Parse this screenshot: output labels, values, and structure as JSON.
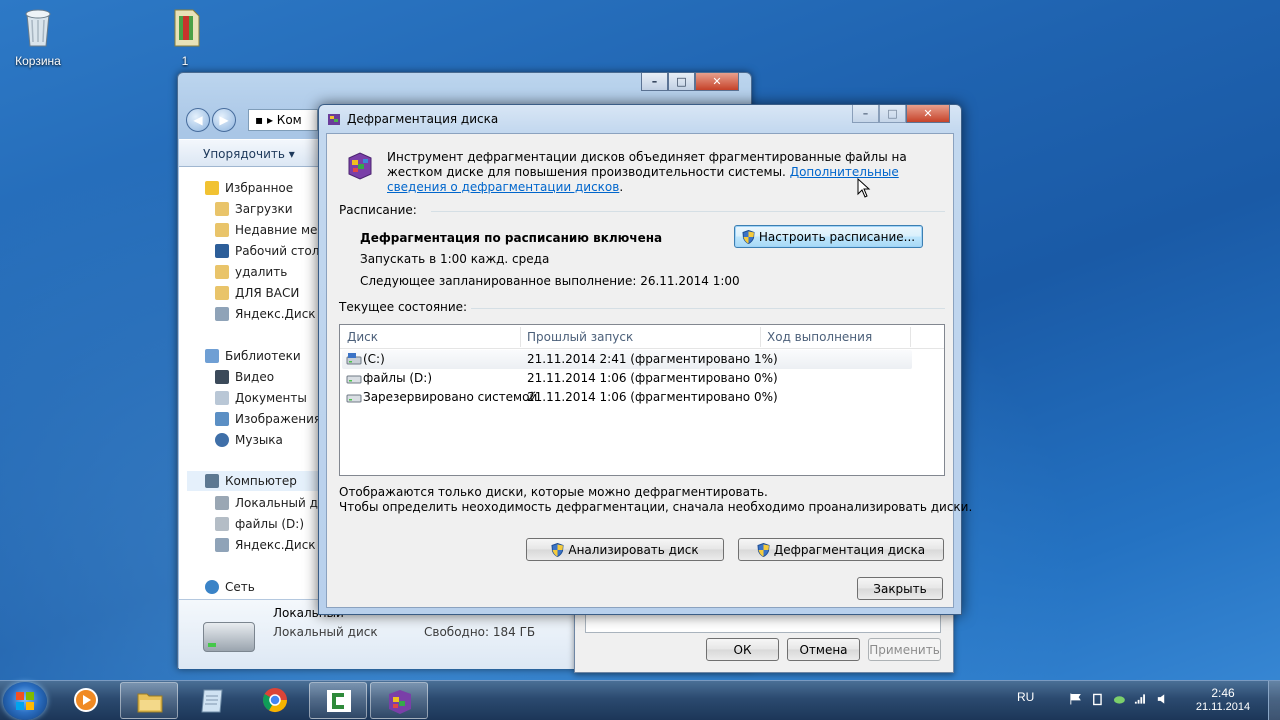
{
  "desktop": {
    "icons": [
      {
        "label": "Корзина",
        "icon": "recycle-bin-icon"
      },
      {
        "label": "1",
        "icon": "winrar-archive-icon"
      }
    ]
  },
  "explorer": {
    "address": "Ком",
    "toolbar": {
      "organize": "Упорядочить"
    },
    "nav": {
      "favorites": "Избранное",
      "downloads": "Загрузки",
      "recent": "Недавние мест",
      "desktop": "Рабочий стол",
      "delete": "удалить",
      "vasya": "ДЛЯ ВАСИ",
      "yadisk": "Яндекс.Диск",
      "libraries": "Библиотеки",
      "video": "Видео",
      "documents": "Документы",
      "images": "Изображения",
      "music": "Музыка",
      "computer": "Компьютер",
      "local_disk": "Локальный дис",
      "files_d": "файлы (D:)",
      "yadisk2": "Яндекс.Диск",
      "network": "Сеть"
    },
    "details": {
      "name": "Локальный",
      "type": "Локальный диск",
      "free_label": "Свободно: 184 ГБ"
    }
  },
  "properties": {
    "ok": "ОК",
    "cancel": "Отмена",
    "apply": "Применить"
  },
  "defrag": {
    "title": "Дефрагментация диска",
    "intro": "Инструмент дефрагментации дисков объединяет фрагментированные файлы на жестком диске для повышения производительности системы.",
    "intro_link": "Дополнительные сведения о дефрагментации дисков",
    "schedule_section": "Расписание:",
    "schedule_status": "Дефрагментация по расписанию включена",
    "schedule_run": "Запускать в 1:00 кажд. среда",
    "schedule_next": "Следующее запланированное выполнение: 26.11.2014 1:00",
    "configure_button": "Настроить расписание...",
    "current_section": "Текущее состояние:",
    "columns": [
      "Диск",
      "Прошлый запуск",
      "Ход выполнения"
    ],
    "disks": [
      {
        "name": "(C:)",
        "last_run": "21.11.2014 2:41 (фрагментировано 1%)",
        "progress": ""
      },
      {
        "name": "файлы (D:)",
        "last_run": "21.11.2014 1:06 (фрагментировано 0%)",
        "progress": ""
      },
      {
        "name": "Зарезервировано системой",
        "last_run": "21.11.2014 1:06 (фрагментировано 0%)",
        "progress": ""
      }
    ],
    "note1": "Отображаются только диски, которые можно дефрагментировать.",
    "note2": "Чтобы определить неоходимость  дефрагментации, сначала необходимо проанализировать диски.",
    "analyze_button": "Анализировать диск",
    "defrag_button": "Дефрагментация диска",
    "close_button": "Закрыть"
  },
  "taskbar": {
    "apps": [
      "media-player-icon",
      "explorer-icon",
      "notepad-icon",
      "chrome-icon",
      "camtasia-icon",
      "defrag-icon"
    ],
    "lang": "RU",
    "time": "2:46",
    "date": "21.11.2014"
  }
}
